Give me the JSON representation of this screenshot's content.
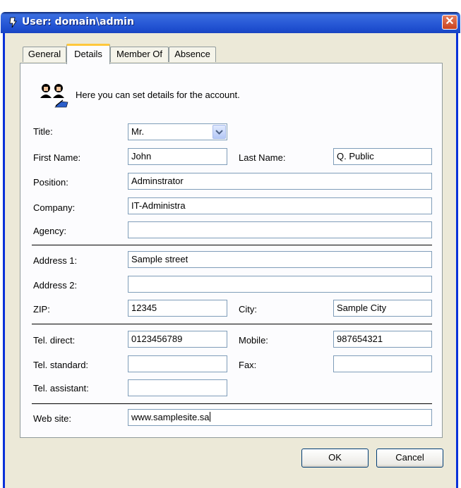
{
  "window": {
    "title": "User: domain\\admin",
    "close_glyph": "✕"
  },
  "tabs": [
    {
      "label": "General",
      "active": false
    },
    {
      "label": "Details",
      "active": true
    },
    {
      "label": "Member Of",
      "active": false
    },
    {
      "label": "Absence",
      "active": false
    }
  ],
  "intro": {
    "text": "Here you can set details for the account.",
    "icon": "users-icon"
  },
  "form": {
    "title": {
      "label": "Title:",
      "value": "Mr."
    },
    "first_name": {
      "label": "First Name:",
      "value": "John"
    },
    "last_name": {
      "label": "Last Name:",
      "value": "Q. Public"
    },
    "position": {
      "label": "Position:",
      "value": "Adminstrator"
    },
    "company": {
      "label": "Company:",
      "value": "IT-Administra"
    },
    "agency": {
      "label": "Agency:",
      "value": ""
    },
    "address1": {
      "label": "Address 1:",
      "value": "Sample street"
    },
    "address2": {
      "label": "Address 2:",
      "value": ""
    },
    "zip": {
      "label": "ZIP:",
      "value": "12345"
    },
    "city": {
      "label": "City:",
      "value": "Sample City"
    },
    "tel_direct": {
      "label": "Tel. direct:",
      "value": "0123456789"
    },
    "mobile": {
      "label": "Mobile:",
      "value": "987654321"
    },
    "tel_standard": {
      "label": "Tel. standard:",
      "value": ""
    },
    "fax": {
      "label": "Fax:",
      "value": ""
    },
    "tel_assistant": {
      "label": "Tel. assistant:",
      "value": ""
    },
    "website": {
      "label": "Web site:",
      "value": "www.samplesite.sa"
    }
  },
  "buttons": {
    "ok": "OK",
    "cancel": "Cancel"
  },
  "colors": {
    "titlebar": "#2A5BD7",
    "window_bg": "#ECE9D8",
    "active_tab_accent": "#FFC83C",
    "field_border": "#7F9DB9"
  }
}
